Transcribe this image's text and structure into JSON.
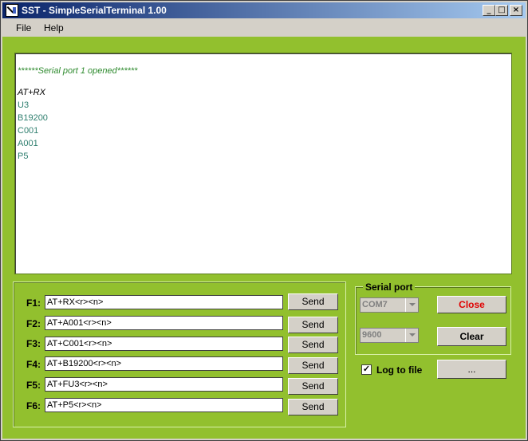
{
  "window": {
    "title": "SST - SimpleSerialTerminal 1.00"
  },
  "titlebar_buttons": {
    "minimize": "_",
    "maximize": "□",
    "close": "×"
  },
  "menu": {
    "file": "File",
    "help": "Help"
  },
  "terminal": {
    "lines": [
      {
        "text": "******Serial port 1 opened******",
        "style": "green"
      },
      {
        "text": "AT+RX",
        "style": "black"
      },
      {
        "text": "U3",
        "style": "teal"
      },
      {
        "text": "B19200",
        "style": "teal"
      },
      {
        "text": "C001",
        "style": "teal"
      },
      {
        "text": "A001",
        "style": "teal"
      },
      {
        "text": "P5",
        "style": "teal"
      }
    ]
  },
  "function_keys": [
    {
      "label": "F1:",
      "value": "AT+RX<r><n>",
      "send": "Send"
    },
    {
      "label": "F2:",
      "value": "AT+A001<r><n>",
      "send": "Send"
    },
    {
      "label": "F3:",
      "value": "AT+C001<r><n>",
      "send": "Send"
    },
    {
      "label": "F4:",
      "value": "AT+B19200<r><n>",
      "send": "Send"
    },
    {
      "label": "F5:",
      "value": "AT+FU3<r><n>",
      "send": "Send"
    },
    {
      "label": "F6:",
      "value": "AT+P5<r><n>",
      "send": "Send"
    }
  ],
  "serial_port": {
    "legend": "Serial port",
    "port": "COM7",
    "baud": "9600",
    "close_label": "Close",
    "clear_label": "Clear"
  },
  "log": {
    "label": "Log to file",
    "checked": true,
    "browse_label": "..."
  },
  "colors": {
    "background": "#92c02e",
    "close_text": "#e00000",
    "title_start": "#0a246a",
    "title_end": "#a6caf0"
  }
}
